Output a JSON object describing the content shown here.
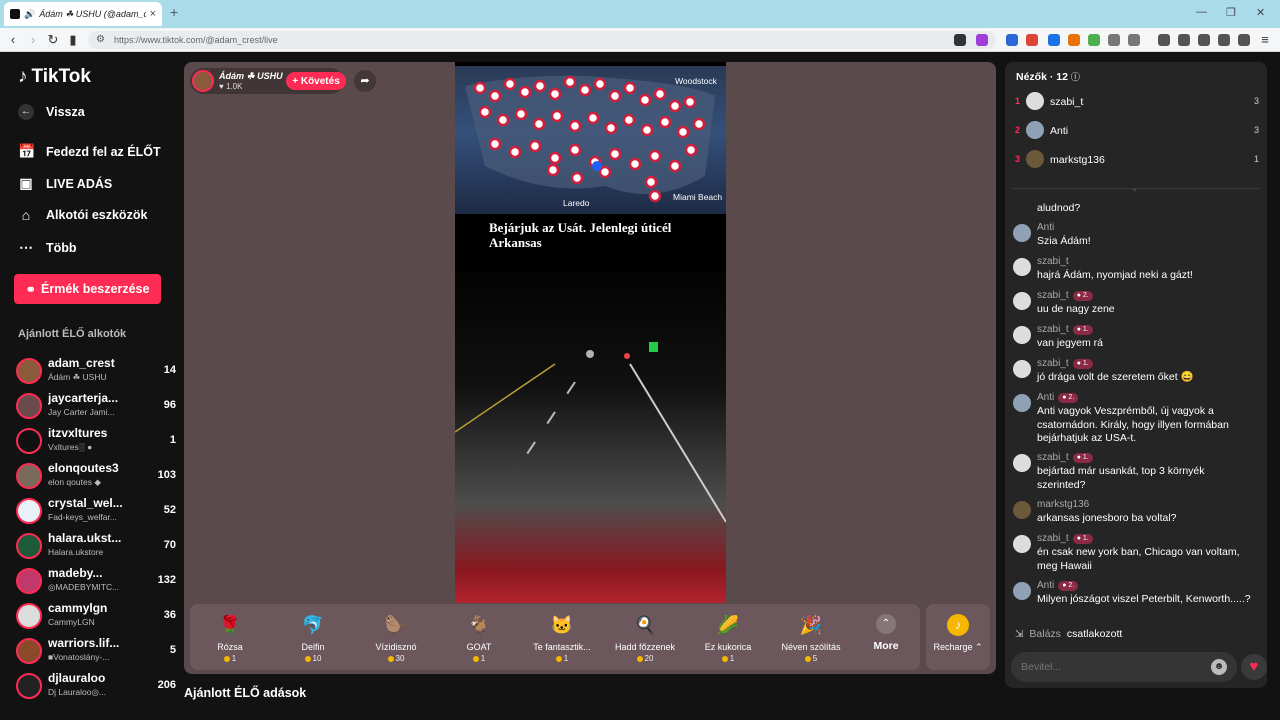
{
  "browser": {
    "tab_title": "Ádám ☘ USHU (@adam_crest",
    "tab_close": "×",
    "new_tab": "+",
    "url": "https://www.tiktok.com/@adam_crest/live"
  },
  "sidebar": {
    "logo": "TikTok",
    "back": "Vissza",
    "items": [
      {
        "label": "Fedezd fel az ÉLŐT",
        "icon": "calendar-icon"
      },
      {
        "label": "LIVE ADÁS",
        "icon": "camera-icon"
      },
      {
        "label": "Alkotói eszközök",
        "icon": "house-icon"
      },
      {
        "label": "Több",
        "icon": "dots-icon"
      }
    ],
    "coins_button": "Érmék beszerzése",
    "recommended_title": "Ajánlott ÉLŐ alkotók",
    "creators": [
      {
        "name": "adam_crest",
        "sub": "Ádám ☘ USHU",
        "count": "14"
      },
      {
        "name": "jaycarterja...",
        "sub": "Jay Carter Jami...",
        "count": "96"
      },
      {
        "name": "itzvxltures",
        "sub": "Vxltures░ ●",
        "count": "1"
      },
      {
        "name": "elonqoutes3",
        "sub": "elon qoutes ◆",
        "count": "103"
      },
      {
        "name": "crystal_wel...",
        "sub": "Fad-keys_welfar...",
        "count": "52"
      },
      {
        "name": "halara.ukst...",
        "sub": "Halara.ukstore",
        "count": "70"
      },
      {
        "name": "madeby...",
        "sub": "◎MADEBYMITC...",
        "count": "132"
      },
      {
        "name": "cammylgn",
        "sub": "CammyLGN",
        "count": "36"
      },
      {
        "name": "warriors.lif...",
        "sub": "■Vonatoslány-...",
        "count": "5"
      },
      {
        "name": "djlauraloo",
        "sub": "Dj Lauraloo◎...",
        "count": "206"
      }
    ]
  },
  "stream": {
    "host_name": "Ádám ☘ USHU",
    "likes": "♥ 1.0K",
    "follow": "+ Követés",
    "caption_line1": "Bejárjuk az Usát. Jelenlegi úticél",
    "caption_line2": "Arkansas",
    "map_labels": [
      "Woodstock",
      "Laredo",
      "Miami Beach"
    ]
  },
  "gifts": [
    {
      "name": "Rózsa",
      "price": "1",
      "icon": "🌹"
    },
    {
      "name": "Delfin",
      "price": "10",
      "icon": "🐬"
    },
    {
      "name": "Vízidisznó",
      "price": "30",
      "icon": "🦫"
    },
    {
      "name": "GOAT",
      "price": "1",
      "icon": "🐐"
    },
    {
      "name": "Te fantasztik...",
      "price": "1",
      "icon": "🐱"
    },
    {
      "name": "Hadd főzzenek",
      "price": "20",
      "icon": "🍳"
    },
    {
      "name": "Ez kukorica",
      "price": "1",
      "icon": "🌽"
    },
    {
      "name": "Néven szólítás",
      "price": "5",
      "icon": "🎉"
    }
  ],
  "more_label": "More",
  "recharge_label": "Recharge",
  "bottom_title": "Ajánlott ÉLŐ adások",
  "panel": {
    "viewers_title": "Nézők · 12",
    "top_viewers": [
      {
        "rank": "1",
        "name": "szabi_t",
        "score": "3"
      },
      {
        "rank": "2",
        "name": "Anti",
        "score": "3"
      },
      {
        "rank": "3",
        "name": "markstg136",
        "score": "1"
      }
    ],
    "prev_tail": "aludnod?",
    "messages": [
      {
        "user": "Anti",
        "badge": "",
        "text": "Szia Ádám!"
      },
      {
        "user": "szabi_t",
        "badge": "",
        "text": "hajrá Ádám, nyomjad neki a gázt!"
      },
      {
        "user": "szabi_t",
        "badge": "2.",
        "text": "uu de nagy zene"
      },
      {
        "user": "szabi_t",
        "badge": "1.",
        "text": "van jegyem rá"
      },
      {
        "user": "szabi_t",
        "badge": "1.",
        "text": "jó drága volt de szeretem őket 😄"
      },
      {
        "user": "Anti",
        "badge": "2.",
        "text": "Anti vagyok Veszprémből, új vagyok a csatornádon. Király, hogy illyen formában bejárhatjuk az USA-t."
      },
      {
        "user": "szabi_t",
        "badge": "1.",
        "text": "bejártad már usankát, top 3 környék szerinted?"
      },
      {
        "user": "markstg136",
        "badge": "",
        "text": "arkansas jonesboro ba voltal?"
      },
      {
        "user": "szabi_t",
        "badge": "1.",
        "text": "én csak new york ban, Chicago van voltam, meg Hawaii"
      },
      {
        "user": "Anti",
        "badge": "2.",
        "text": "Milyen jószágot viszel Peterbilt, Kenworth.....?"
      }
    ],
    "joined_name": "Balázs",
    "joined_text": "csatlakozott",
    "input_placeholder": "Bevitel..."
  }
}
